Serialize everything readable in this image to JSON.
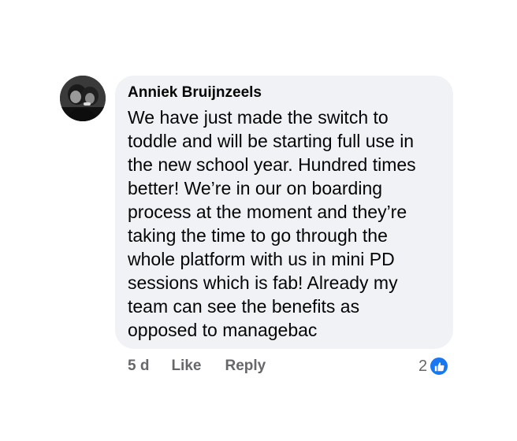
{
  "comment": {
    "author": "Anniek Bruijnzeels",
    "lines": [
      "We have just made the switch to",
      "toddle and will be starting full use in",
      "the new school year. Hundred times",
      "better! We’re in our on boarding",
      "process at the moment and they’re",
      "taking the time to go through the",
      "whole platform with us in mini PD",
      "sessions which is fab! Already my",
      "team can see the benefits as",
      "opposed to managebac"
    ],
    "avatar_icon": "profile-photo"
  },
  "actions": {
    "time": "5 d",
    "like_label": "Like",
    "reply_label": "Reply"
  },
  "reactions": {
    "count": "2",
    "icon": "thumbs-up-icon",
    "badge_color": "#1877f2"
  },
  "colors": {
    "bubble": "#f0f2f5",
    "text": "#050505",
    "secondary": "#65676b"
  }
}
